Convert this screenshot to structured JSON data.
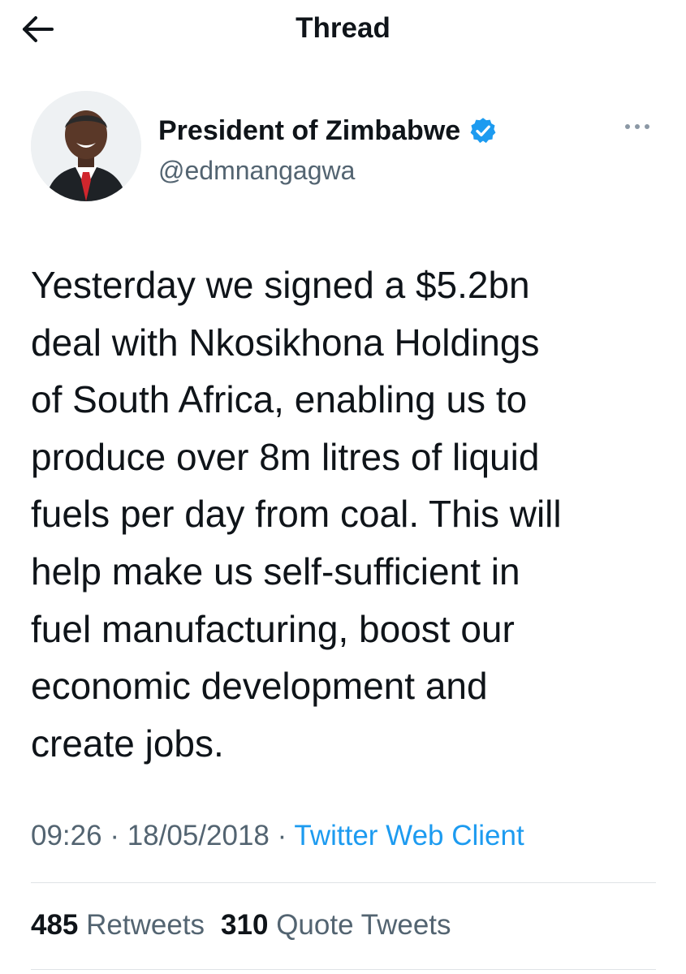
{
  "header": {
    "title": "Thread",
    "back_icon": "arrow-left-icon"
  },
  "author": {
    "name": "President of Zimbabwe",
    "handle": "@edmnangagwa",
    "verified": true,
    "verified_color": "#1d9bf0",
    "avatar_icon": "profile-photo",
    "more_icon": "more-options-icon"
  },
  "tweet": {
    "text": "Yesterday we signed a $5.2bn\ndeal with Nkosikhona Holdings\nof South Africa, enabling us to\nproduce over 8m litres of liquid\nfuels per day from coal. This will\nhelp make us self-sufficient in\nfuel manufacturing, boost our\neconomic development and\ncreate jobs.",
    "time": "09:26",
    "date": "18/05/2018",
    "source": "Twitter Web Client",
    "separator": "·"
  },
  "stats": {
    "retweets_count": "485",
    "retweets_label": "Retweets",
    "quotes_count": "310",
    "quotes_label": "Quote Tweets"
  },
  "colors": {
    "text": "#0f1419",
    "secondary": "#536471",
    "link": "#1d9bf0",
    "divider": "#dfe3e6"
  }
}
